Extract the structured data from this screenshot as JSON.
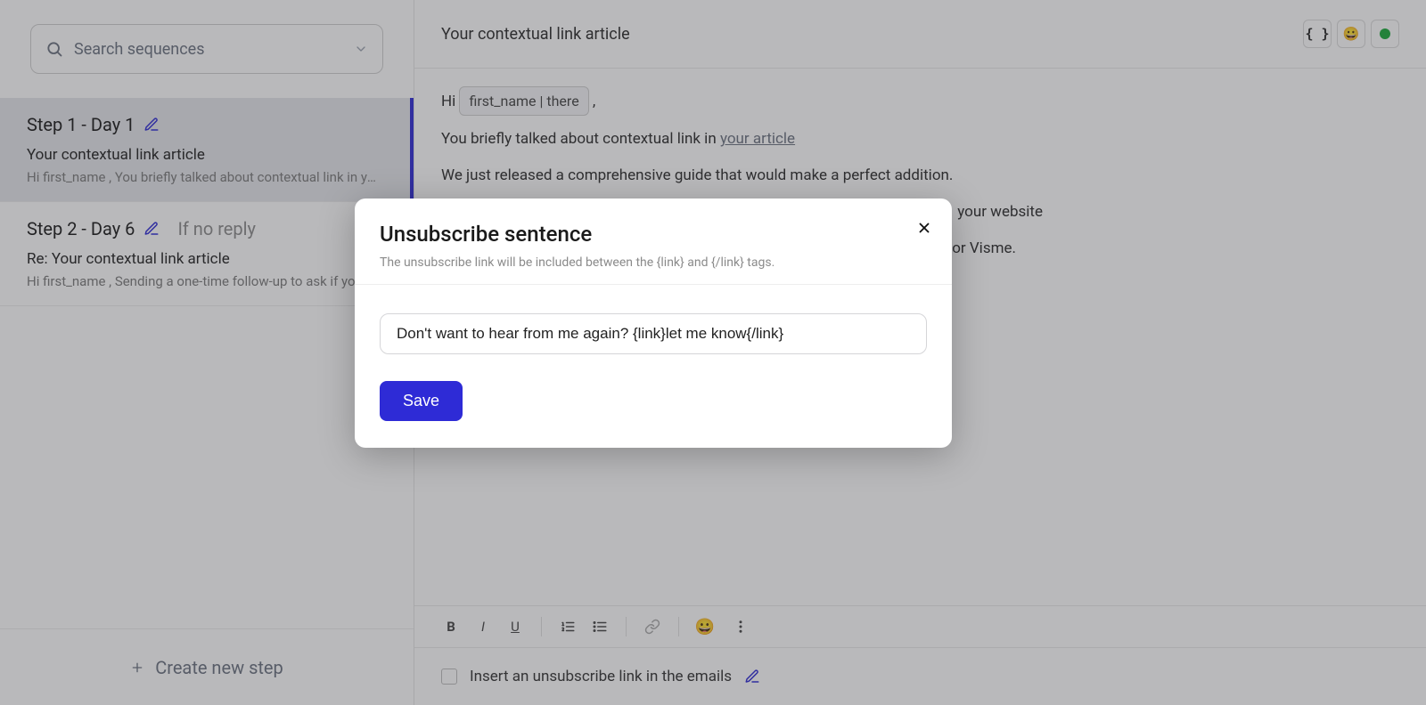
{
  "sidebar": {
    "search_placeholder": "Search sequences",
    "steps": [
      {
        "title": "Step 1 - Day 1",
        "condition": "",
        "subject": "Your contextual link article",
        "preview": "Hi first_name , You briefly talked about contextual link in you…",
        "active": true
      },
      {
        "title": "Step 2 - Day 6",
        "condition": "If no reply",
        "subject": "Re: Your contextual link article",
        "preview": "Hi first_name , Sending a one-time follow-up to ask if you…",
        "active": false
      }
    ],
    "create_label": "Create new step"
  },
  "editor": {
    "subject": "Your contextual link article",
    "greeting_prefix": "Hi ",
    "name_tag": "first_name | there",
    "greeting_suffix": ",",
    "p1_pre": "You briefly talked about contextual link in ",
    "p1_link": "your article",
    "p2": "We just released a comprehensive guide that would make a perfect addition.",
    "p3_tail": "your website",
    "p4_tail": "or Visme.",
    "unsubscribe_label": "Insert an unsubscribe link in the emails"
  },
  "modal": {
    "title": "Unsubscribe sentence",
    "description": "The unsubscribe link will be included between the {link} and {/link} tags.",
    "input_value": "Don't want to hear from me again? {link}let me know{/link}",
    "save_label": "Save"
  },
  "icons": {
    "emoji": "😀"
  }
}
